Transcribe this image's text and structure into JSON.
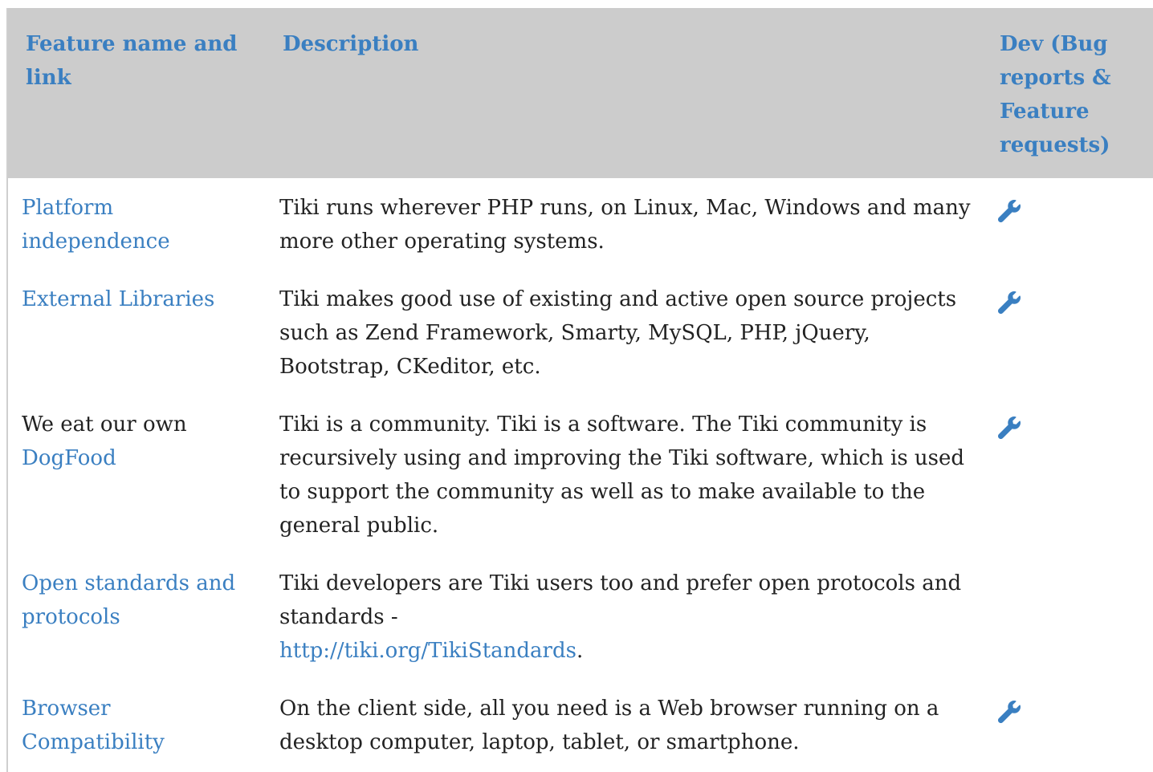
{
  "table": {
    "headers": {
      "feature": "Feature name and link",
      "description": "Description",
      "dev": "Dev (Bug reports & Feature requests)"
    },
    "rows": [
      {
        "feature_prefix": "",
        "feature_link": "Platform independence",
        "description": "Tiki runs wherever PHP runs, on Linux, Mac, Windows and many more other operating systems.",
        "description_link": "",
        "description_suffix": "",
        "dev_icon": "wrench-icon"
      },
      {
        "feature_prefix": "",
        "feature_link": "External Libraries",
        "description": "Tiki makes good use of existing and active open source projects such as Zend Framework, Smarty, MySQL, PHP, jQuery, Bootstrap, CKeditor, etc.",
        "description_link": "",
        "description_suffix": "",
        "dev_icon": "wrench-icon"
      },
      {
        "feature_prefix": "We eat our own ",
        "feature_link": "DogFood",
        "description": "Tiki is a community. Tiki is a software. The Tiki community is recursively using and improving the Tiki software, which is used to support the community as well as to make available to the general public.",
        "description_link": "",
        "description_suffix": "",
        "dev_icon": "wrench-icon"
      },
      {
        "feature_prefix": "",
        "feature_link": "Open standards and protocols",
        "description": "Tiki developers are Tiki users too and prefer open protocols and standards -",
        "description_link": "http://tiki.org/TikiStandards",
        "description_suffix": ".",
        "dev_icon": ""
      },
      {
        "feature_prefix": "",
        "feature_link": "Browser Compatibility",
        "description": "On the client side, all you need is a Web browser running on a desktop computer, laptop, tablet, or smartphone.",
        "description_link": "",
        "description_suffix": "",
        "dev_icon": "wrench-icon"
      }
    ]
  },
  "colors": {
    "header_bg": "#cccccc",
    "link": "#3a7fc1",
    "text": "#222222"
  }
}
